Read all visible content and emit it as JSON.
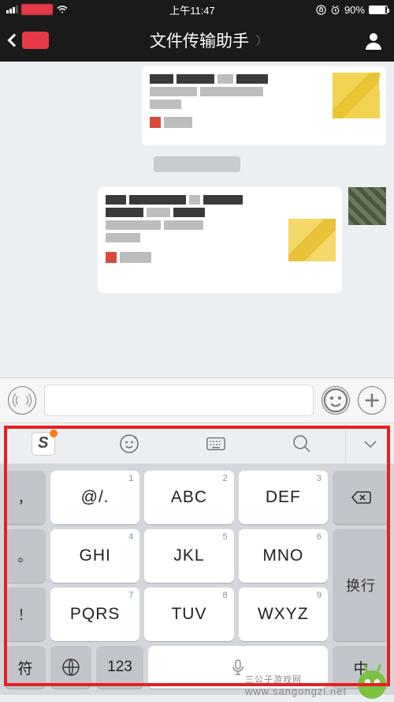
{
  "status": {
    "time": "上午11:47",
    "battery": "90%",
    "lock_icon": "lock-icon",
    "alarm_icon": "alarm-icon"
  },
  "nav": {
    "title": "文件传输助手"
  },
  "input_bar": {
    "placeholder": ""
  },
  "keyboard": {
    "toolbar": {
      "logo": "S"
    },
    "keys": [
      {
        "num": "1",
        "label": "@/."
      },
      {
        "num": "2",
        "label": "ABC"
      },
      {
        "num": "3",
        "label": "DEF"
      },
      {
        "num": "4",
        "label": "GHI"
      },
      {
        "num": "5",
        "label": "JKL"
      },
      {
        "num": "6",
        "label": "MNO"
      },
      {
        "num": "7",
        "label": "PQRS"
      },
      {
        "num": "8",
        "label": "TUV"
      },
      {
        "num": "9",
        "label": "WXYZ"
      }
    ],
    "left_keys": [
      {
        "label": "，"
      },
      {
        "label": "。"
      },
      {
        "label": "！"
      }
    ],
    "right_keys": {
      "backspace": "⌫",
      "enter": "换行"
    },
    "bottom": {
      "symbol": "符",
      "numeric": "123",
      "chinese": "中"
    }
  },
  "watermark": {
    "text": "www.sangongzi.net",
    "brand": "三公子游戏网"
  }
}
